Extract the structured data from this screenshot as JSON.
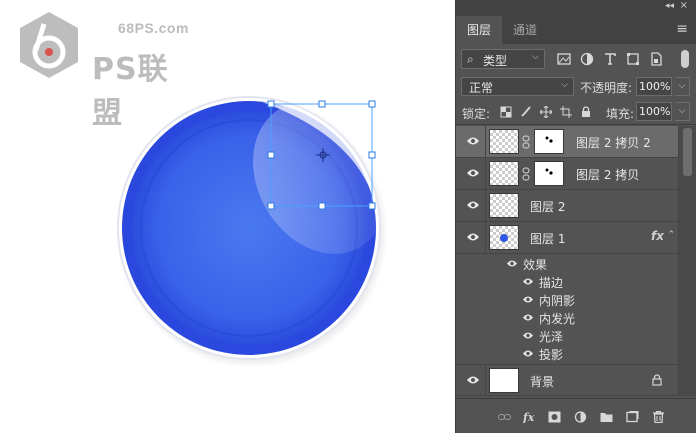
{
  "watermark": {
    "site": "68PS.com",
    "name": "PS联盟"
  },
  "panel": {
    "tabs": [
      {
        "label": "图层"
      },
      {
        "label": "通道"
      }
    ],
    "filter": {
      "label": "类型"
    },
    "blend_mode": "正常",
    "opacity_label": "不透明度:",
    "opacity_value": "100%",
    "lock_label": "锁定:",
    "fill_label": "填充:",
    "fill_value": "100%",
    "layers": [
      {
        "name": "图层 2 拷贝 2",
        "selected": true
      },
      {
        "name": "图层 2 拷贝"
      },
      {
        "name": "图层 2"
      },
      {
        "name": "图层 1",
        "fx": "fx"
      },
      {
        "name": "背景"
      }
    ],
    "effects": {
      "group_label": "效果",
      "items": [
        "描边",
        "内阴影",
        "内发光",
        "光泽",
        "投影"
      ]
    },
    "bottom_icons": [
      "link-icon",
      "fx-icon",
      "mask-icon",
      "adjustment-icon",
      "folder-icon",
      "new-layer-icon",
      "trash-icon"
    ]
  },
  "colors": {
    "orb": "#2f55e6",
    "panel_bg": "#535353",
    "selected_row": "#6b6b6b"
  }
}
